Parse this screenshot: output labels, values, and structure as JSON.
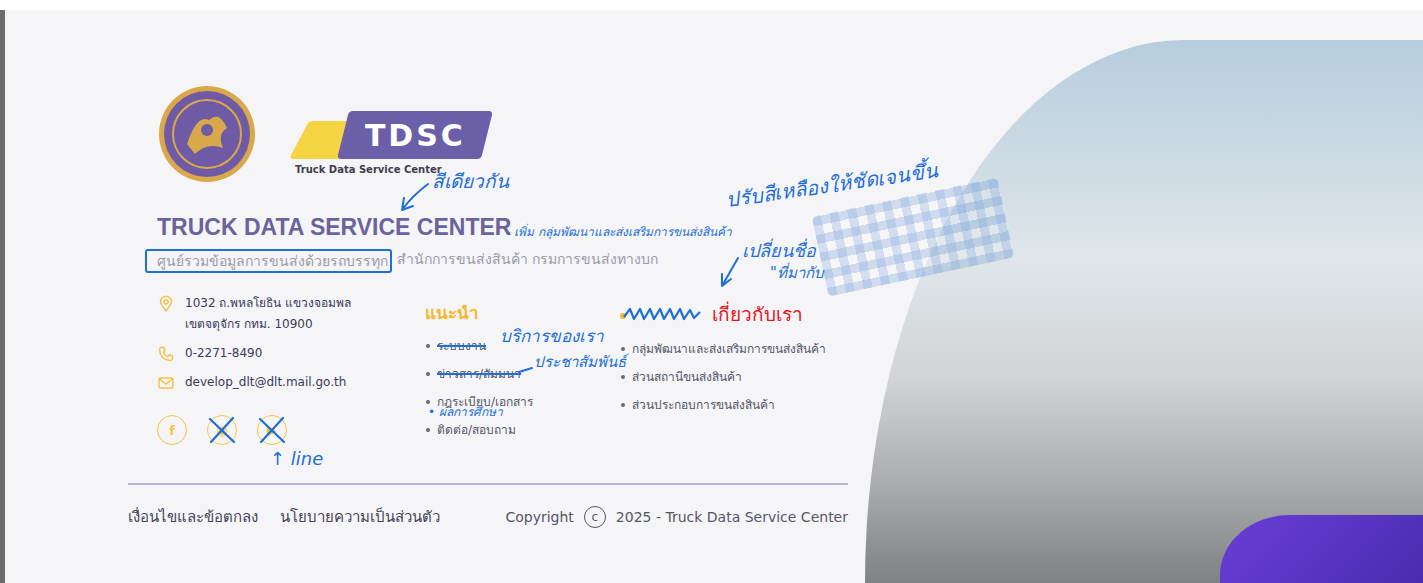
{
  "brand": {
    "mark": "TDSC",
    "tagline": "Truck Data Service Center"
  },
  "title": "TRUCK DATA SERVICE CENTER",
  "subtitle": {
    "boxed": "ศูนย์รวมข้อมูลการขนส่งด้วยรถบรรทุก",
    "rest": "สำนักการขนส่งสินค้า กรมการขนส่งทางบก"
  },
  "contacts": [
    {
      "kind": "address",
      "lines": [
        "1032 ถ.พหลโยธิน แขวงจอมพล",
        "เขตจตุจักร กทม. 10900"
      ]
    },
    {
      "kind": "phone",
      "lines": [
        "0-2271-8490"
      ]
    },
    {
      "kind": "email",
      "lines": [
        "develop_dlt@dlt.mail.go.th"
      ]
    }
  ],
  "social": [
    {
      "glyph": "f",
      "crossed": false
    },
    {
      "glyph": "◉",
      "crossed": true
    },
    {
      "glyph": "▶",
      "crossed": true
    }
  ],
  "columns": [
    {
      "heading": "แนะนำ",
      "scribbled": false,
      "color": "#f5b82e",
      "items": [
        {
          "text": "ระบบงาน",
          "struck": true
        },
        {
          "text": "ข่าวสาร/สัมมนา",
          "struck": true
        },
        {
          "text": "กฎระเบียบ/เอกสาร",
          "struck": false
        },
        {
          "text": "ติดต่อ/สอบถาม",
          "struck": false
        }
      ]
    },
    {
      "heading": "เกี่ยวกับเรา",
      "scribbled": true,
      "color": "#e8141c",
      "items": [
        {
          "text": "กลุ่มพัฒนาและส่งเสริมการขนส่งสินค้า",
          "struck": false
        },
        {
          "text": "ส่วนสถานีขนส่งสินค้า",
          "struck": false
        },
        {
          "text": "ส่วนประกอบการขนส่งสินค้า",
          "struck": false
        }
      ]
    }
  ],
  "notes": [
    "สีเดียวกัน",
    "- เพิ่ม กลุ่มพัฒนาและส่งเสริมการขนส่งสินค้า",
    "ปรับสีเหลืองให้ชัดเจนขึ้น",
    "เปลี่ยนชื่อ",
    "\"ที่มากับ",
    "บริการของเรา",
    "ประชาสัมพันธ์",
    "• ผลการศึกษา",
    "↑ line"
  ],
  "legal": [
    "เงื่อนไขและข้อตกลง",
    "นโยบายความเป็นส่วนตัว"
  ],
  "copyright": {
    "label": "Copyright",
    "symbol": "c",
    "text": "2025 - Truck Data Service Center"
  }
}
